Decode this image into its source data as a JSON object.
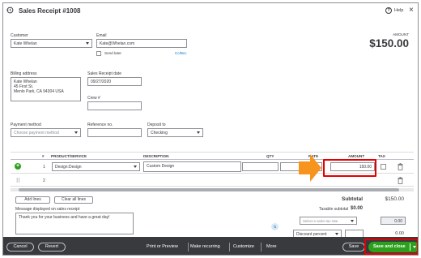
{
  "header": {
    "title": "Sales Receipt #1008",
    "help_label": "Help"
  },
  "customer": {
    "label": "Customer",
    "value": "Kate Whelan"
  },
  "email": {
    "label": "Email",
    "value": "Kate@Whelan.com",
    "cc_bcc": "Cc/Bcc",
    "send_later": "Send later"
  },
  "amount": {
    "label": "AMOUNT",
    "value": "$150.00"
  },
  "billing": {
    "label": "Billing address",
    "lines": [
      "Kate Whelan",
      "45 First St.",
      "Menlo Park, CA 94304 USA"
    ]
  },
  "receipt_date": {
    "label": "Sales Receipt date",
    "value": "09/27/2020"
  },
  "crew": {
    "label": "Crew #",
    "value": ""
  },
  "payment_method": {
    "label": "Payment method",
    "placeholder": "Choose payment method"
  },
  "reference": {
    "label": "Reference no.",
    "value": ""
  },
  "deposit": {
    "label": "Deposit to",
    "value": "Checking"
  },
  "table": {
    "headers": {
      "num": "#",
      "product": "PRODUCT/SERVICE",
      "description": "DESCRIPTION",
      "qty": "QTY",
      "rate": "RATE",
      "amount": "AMOUNT",
      "tax": "TAX"
    },
    "rows": [
      {
        "num": "1",
        "product": "Design:Design",
        "description": "Custom Design",
        "qty": "",
        "rate": "",
        "amount": "150.00"
      },
      {
        "num": "2",
        "product": "",
        "description": "",
        "qty": "",
        "rate": "",
        "amount": ""
      }
    ]
  },
  "table_actions": {
    "add_lines": "Add lines",
    "clear_all_lines": "Clear all lines"
  },
  "message": {
    "label": "Message displayed on sales receipt",
    "value": "Thank you for your business and have a great day!"
  },
  "totals": {
    "subtotal_label": "Subtotal",
    "subtotal_value": "$150.00",
    "taxable_label": "Taxable subtotal",
    "taxable_value": "$0.00",
    "tax_rate_placeholder": "Select a sales tax rate",
    "tax_value": "0.00",
    "discount_label": "Discount percent",
    "discount_value": "0.00"
  },
  "footer": {
    "cancel": "Cancel",
    "revert": "Revert",
    "print_preview": "Print or Preview",
    "make_recurring": "Make recurring",
    "customize": "Customize",
    "more": "More",
    "save": "Save",
    "save_close": "Save and close"
  },
  "colors": {
    "green": "#2ca01c",
    "orange": "#f7941d",
    "highlight_red": "#e30000",
    "footer_bg": "#393a3d"
  }
}
